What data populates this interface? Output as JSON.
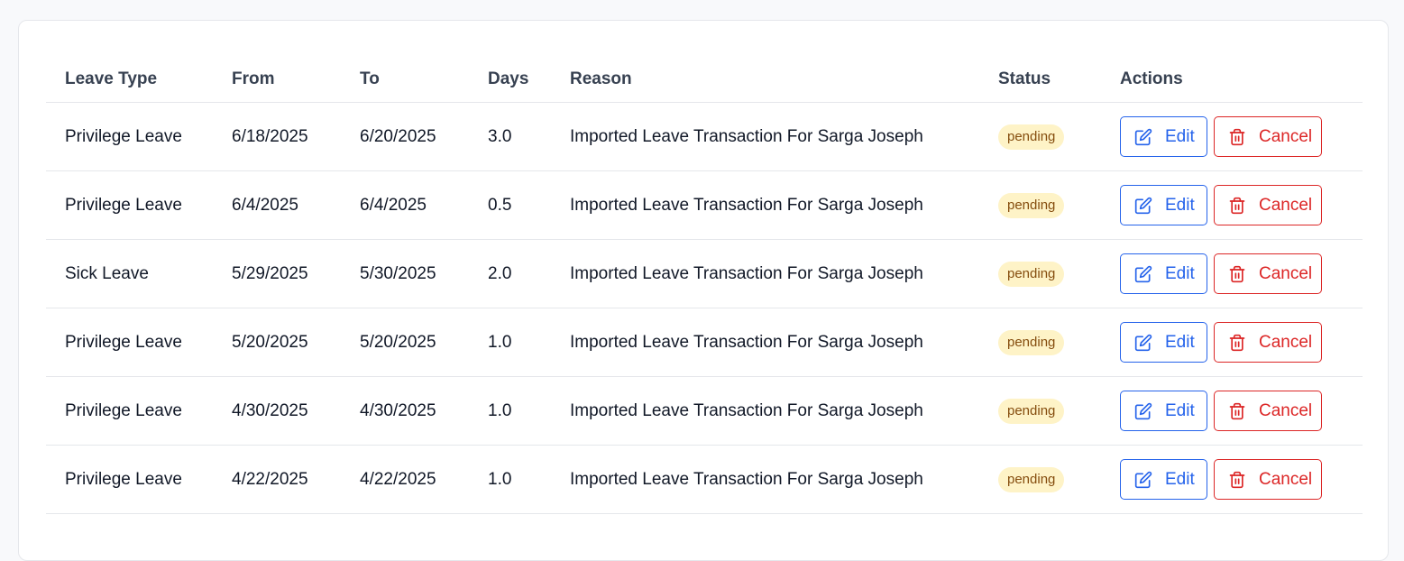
{
  "table": {
    "headers": {
      "leave_type": "Leave Type",
      "from": "From",
      "to": "To",
      "days": "Days",
      "reason": "Reason",
      "status": "Status",
      "actions": "Actions"
    },
    "rows": [
      {
        "leave_type": "Privilege Leave",
        "from": "6/18/2025",
        "to": "6/20/2025",
        "days": "3.0",
        "reason": "Imported Leave Transaction For Sarga Joseph",
        "status": "pending"
      },
      {
        "leave_type": "Privilege Leave",
        "from": "6/4/2025",
        "to": "6/4/2025",
        "days": "0.5",
        "reason": "Imported Leave Transaction For Sarga Joseph",
        "status": "pending"
      },
      {
        "leave_type": "Sick Leave",
        "from": "5/29/2025",
        "to": "5/30/2025",
        "days": "2.0",
        "reason": "Imported Leave Transaction For Sarga Joseph",
        "status": "pending"
      },
      {
        "leave_type": "Privilege Leave",
        "from": "5/20/2025",
        "to": "5/20/2025",
        "days": "1.0",
        "reason": "Imported Leave Transaction For Sarga Joseph",
        "status": "pending"
      },
      {
        "leave_type": "Privilege Leave",
        "from": "4/30/2025",
        "to": "4/30/2025",
        "days": "1.0",
        "reason": "Imported Leave Transaction For Sarga Joseph",
        "status": "pending"
      },
      {
        "leave_type": "Privilege Leave",
        "from": "4/22/2025",
        "to": "4/22/2025",
        "days": "1.0",
        "reason": "Imported Leave Transaction For Sarga Joseph",
        "status": "pending"
      }
    ],
    "actions": {
      "edit_label": "Edit",
      "cancel_label": "Cancel",
      "edit_icon": "edit-icon",
      "cancel_icon": "trash-icon"
    }
  },
  "colors": {
    "edit": "#2563eb",
    "cancel": "#dc2626",
    "pending_bg": "#fef3c7",
    "pending_text": "#854d0e"
  }
}
